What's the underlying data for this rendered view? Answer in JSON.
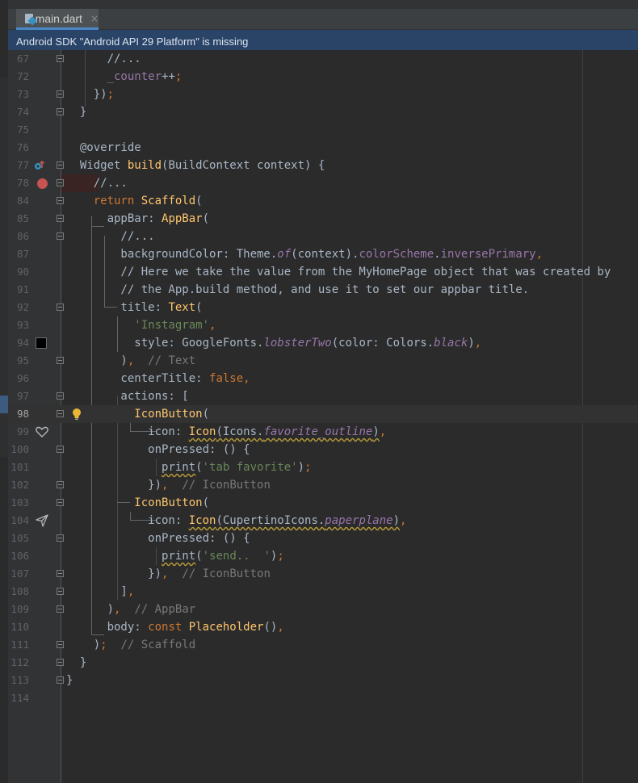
{
  "tab": {
    "file_name": "main.dart",
    "close_glyph": "×",
    "icon": "dart-file-icon"
  },
  "banner": {
    "message": "Android SDK \"Android API 29 Platform\" is missing"
  },
  "colors": {
    "keyword": "#cc7832",
    "function": "#ffc66d",
    "annotation": "#bbb529",
    "string": "#6a8759",
    "comment": "#808080",
    "field": "#9876aa",
    "breakpoint": "#c75450",
    "banner": "#2a4468"
  },
  "gutter_icons": [
    "override-icon",
    "breakpoint-icon",
    "color-swatch-icon",
    "bulb-icon",
    "heart-icon",
    "paperplane-icon"
  ],
  "lines": [
    {
      "num": "67",
      "text": "      //..."
    },
    {
      "num": "72",
      "text": "      _counter++;"
    },
    {
      "num": "73",
      "text": "    });"
    },
    {
      "num": "74",
      "text": "  }"
    },
    {
      "num": "75",
      "text": ""
    },
    {
      "num": "76",
      "text": "  @override"
    },
    {
      "num": "77",
      "text": "  Widget build(BuildContext context) {"
    },
    {
      "num": "78",
      "text": "    //..."
    },
    {
      "num": "84",
      "text": "    return Scaffold("
    },
    {
      "num": "85",
      "text": "      appBar: AppBar("
    },
    {
      "num": "86",
      "text": "        //..."
    },
    {
      "num": "87",
      "text": "        backgroundColor: Theme.of(context).colorScheme.inversePrimary,"
    },
    {
      "num": "90",
      "text": "        // Here we take the value from the MyHomePage object that was created by"
    },
    {
      "num": "91",
      "text": "        // the App.build method, and use it to set our appbar title."
    },
    {
      "num": "92",
      "text": "        title: Text("
    },
    {
      "num": "93",
      "text": "          'Instagram',"
    },
    {
      "num": "94",
      "text": "          style: GoogleFonts.lobsterTwo(color: Colors.black),"
    },
    {
      "num": "95",
      "text": "        ),  // Text"
    },
    {
      "num": "96",
      "text": "        centerTitle: false,"
    },
    {
      "num": "97",
      "text": "        actions: ["
    },
    {
      "num": "98",
      "text": "          IconButton("
    },
    {
      "num": "99",
      "text": "            icon: Icon(Icons.favorite_outline),"
    },
    {
      "num": "100",
      "text": "            onPressed: () {"
    },
    {
      "num": "101",
      "text": "              print('tab favorite');"
    },
    {
      "num": "102",
      "text": "            }),  // IconButton"
    },
    {
      "num": "103",
      "text": "          IconButton("
    },
    {
      "num": "104",
      "text": "            icon: Icon(CupertinoIcons.paperplane),"
    },
    {
      "num": "105",
      "text": "            onPressed: () {"
    },
    {
      "num": "106",
      "text": "              print('send..  ');"
    },
    {
      "num": "107",
      "text": "            }),  // IconButton"
    },
    {
      "num": "108",
      "text": "        ],"
    },
    {
      "num": "109",
      "text": "      ),  // AppBar"
    },
    {
      "num": "110",
      "text": "      body: const Placeholder(),"
    },
    {
      "num": "111",
      "text": "    );  // Scaffold"
    },
    {
      "num": "112",
      "text": "  }"
    },
    {
      "num": "113",
      "text": "}"
    },
    {
      "num": "114",
      "text": ""
    }
  ]
}
